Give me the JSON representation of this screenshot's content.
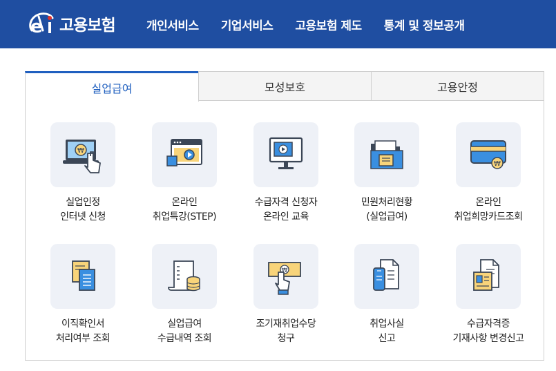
{
  "header": {
    "logo_text": "고용보험",
    "nav": [
      "개인서비스",
      "기업서비스",
      "고용보험 제도",
      "통계 및 정보공개"
    ]
  },
  "tabs": [
    {
      "label": "실업급여",
      "active": true
    },
    {
      "label": "모성보호",
      "active": false
    },
    {
      "label": "고용안정",
      "active": false
    }
  ],
  "items": [
    {
      "line1": "실업인정",
      "line2": "인터넷 신청",
      "icon": "laptop-touch-icon"
    },
    {
      "line1": "온라인",
      "line2": "취업특강(STEP)",
      "icon": "video-lecture-icon"
    },
    {
      "line1": "수급자격 신청자",
      "line2": "온라인 교육",
      "icon": "monitor-play-icon"
    },
    {
      "line1": "민원처리현황",
      "line2": "(실업급여)",
      "icon": "folder-document-icon"
    },
    {
      "line1": "온라인",
      "line2": "취업희망카드조회",
      "icon": "card-won-icon"
    },
    {
      "line1": "이직확인서",
      "line2": "처리여부 조회",
      "icon": "documents-icon"
    },
    {
      "line1": "실업급여",
      "line2": "수급내역 조회",
      "icon": "receipt-coins-icon"
    },
    {
      "line1": "조기재취업수당",
      "line2": "청구",
      "icon": "bill-hand-icon"
    },
    {
      "line1": "취업사실",
      "line2": "신고",
      "icon": "phone-document-icon"
    },
    {
      "line1": "수급자격증",
      "line2": "기재사항 변경신고",
      "icon": "id-document-icon"
    }
  ],
  "colors": {
    "header_bg": "#1f4ea1",
    "accent": "#1f5fbf",
    "icon_bg": "#eef1f7",
    "icon_blue": "#3a8fe0",
    "icon_yellow": "#f8d47a"
  }
}
